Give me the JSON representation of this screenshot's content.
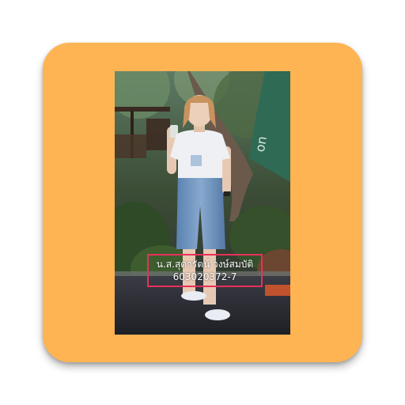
{
  "app_icon": {
    "background_color": "#FFB454",
    "caption": {
      "name": "น.ส.สุดารัตน์ วงษ์สมบัติ",
      "id_number": "603020372-7",
      "border_color": "#E8305A"
    }
  }
}
